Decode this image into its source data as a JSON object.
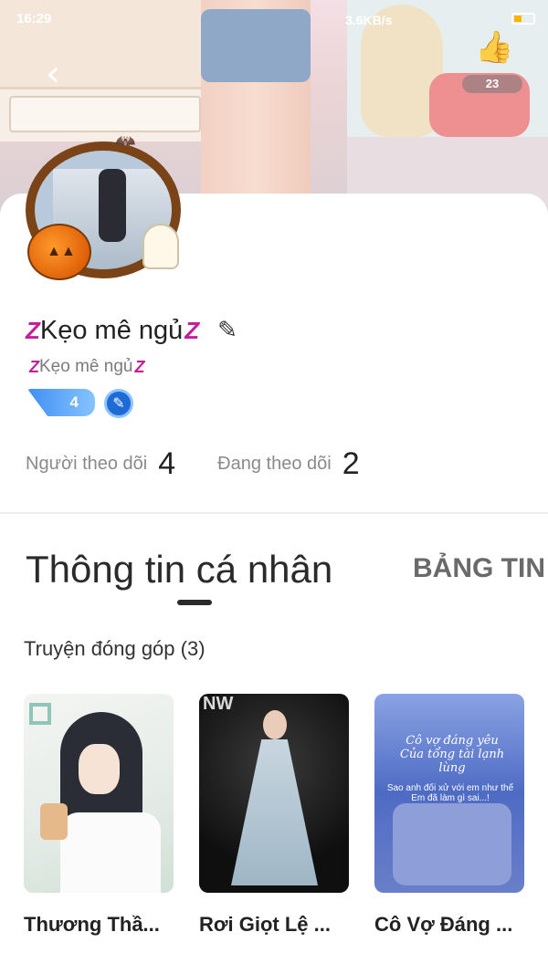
{
  "status_bar": {
    "time": "16:29",
    "network": "3.6KB/s"
  },
  "header": {
    "like_count": "23"
  },
  "profile": {
    "name": "Kẹo mê ngủ",
    "subname": "Kẹo mê ngủ",
    "level": "4",
    "followers_label": "Người theo dõi",
    "followers_count": "4",
    "following_label": "Đang theo dõi",
    "following_count": "2",
    "decor_left": "Z",
    "decor_right": "Z"
  },
  "tabs": {
    "active": "Thông tin cá nhân",
    "other": "BẢNG TIN"
  },
  "section": {
    "title": "Truyện đóng góp (3)"
  },
  "books": [
    {
      "title": "Thương Thầ...",
      "cover_text": ""
    },
    {
      "title": "Rơi Giọt Lệ ...",
      "cover_text": "NW"
    },
    {
      "title": "Cô Vợ Đáng ...",
      "cover_text": "Cô vợ đáng yêu Của tổng tài lạnh lùng",
      "cover_text2": "Sao anh đối xử với em như thế Em đã làm gì sai...!"
    }
  ],
  "colors": {
    "accent_magenta": "#c21f9b",
    "level_blue": "#3f8ff5"
  },
  "icons": {
    "back": "back-arrow-icon",
    "like": "thumbs-up-icon",
    "edit": "pencil-icon",
    "verified": "verified-badge-icon"
  }
}
